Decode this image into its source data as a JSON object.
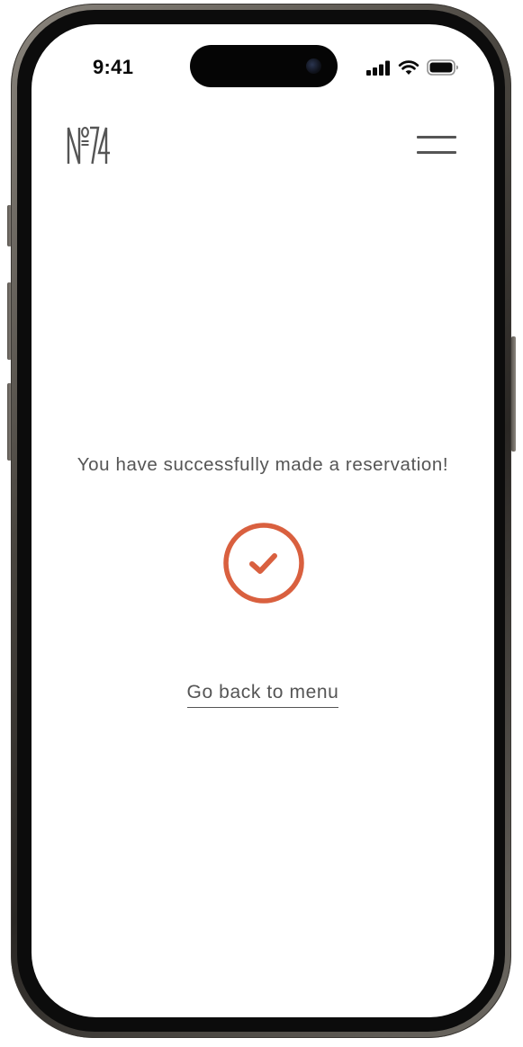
{
  "status_bar": {
    "time": "9:41"
  },
  "header": {
    "logo_text": "№74",
    "menu_icon": "hamburger-menu-icon"
  },
  "main": {
    "success_message": "You have successfully made a reservation!",
    "success_icon": "check-circle-icon",
    "back_link_label": "Go back to menu"
  },
  "colors": {
    "accent": "#D9603F",
    "text": "#555555",
    "background": "#FFFFFF"
  }
}
